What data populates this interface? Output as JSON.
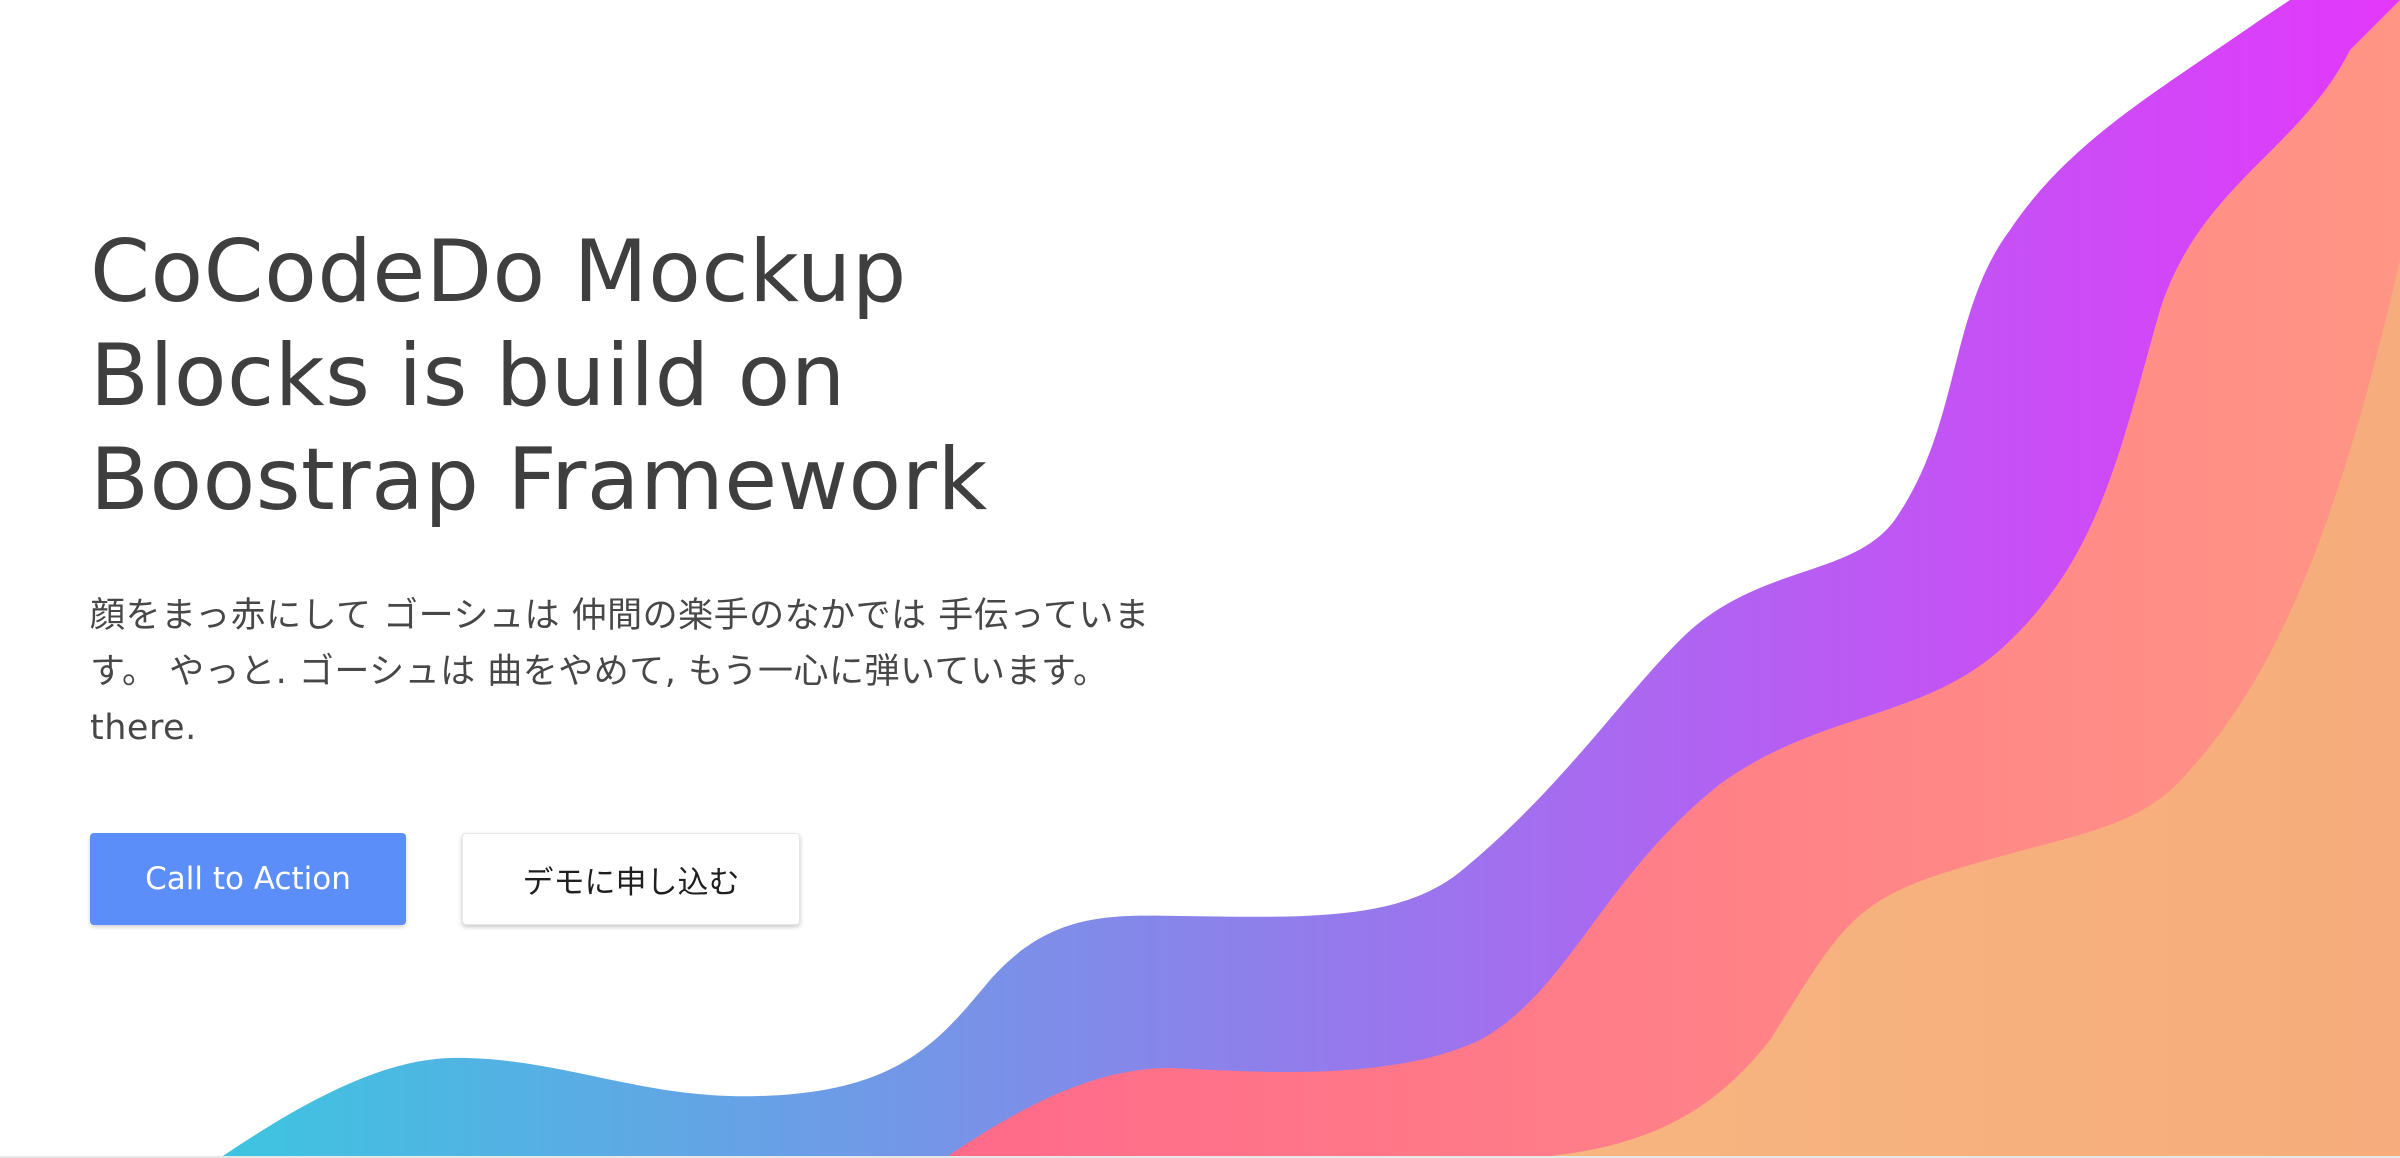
{
  "hero": {
    "headline": "CoCodeDo Mockup Blocks is build on Boostrap Framework",
    "subtext": "顔をまっ赤にして ゴーシュは 仲間の楽手のなかでは 手伝っています。 やっと. ゴーシュは 曲をやめて, もう一心に弾いています。 there.",
    "primary_button_label": "Call to Action",
    "secondary_button_label": "デモに申し込む"
  },
  "colors": {
    "primary_button": "#5b8ef9",
    "headline_text": "#3f3f3f",
    "wave_back_start": "#3dc5e0",
    "wave_back_end": "#e338fb",
    "wave_mid_start": "#ff6a8a",
    "wave_mid_end": "#ff9585",
    "wave_front": "#f7b17f"
  }
}
